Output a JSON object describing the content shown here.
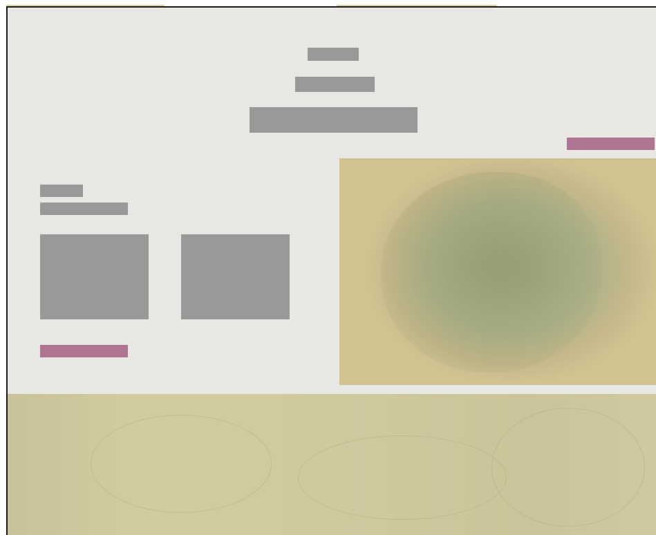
{
  "header": {
    "eyebrow": "",
    "subtitle": "",
    "title": "",
    "action_label": ""
  },
  "main": {
    "section_label": "",
    "section_title": "",
    "cards": [
      {
        "text": ""
      },
      {
        "text": ""
      }
    ],
    "cta_label": ""
  },
  "colors": {
    "accent": "#ad7591",
    "placeholder": "#999999",
    "background": "#e9e7e3",
    "band": "#cfc99e"
  },
  "icons": []
}
